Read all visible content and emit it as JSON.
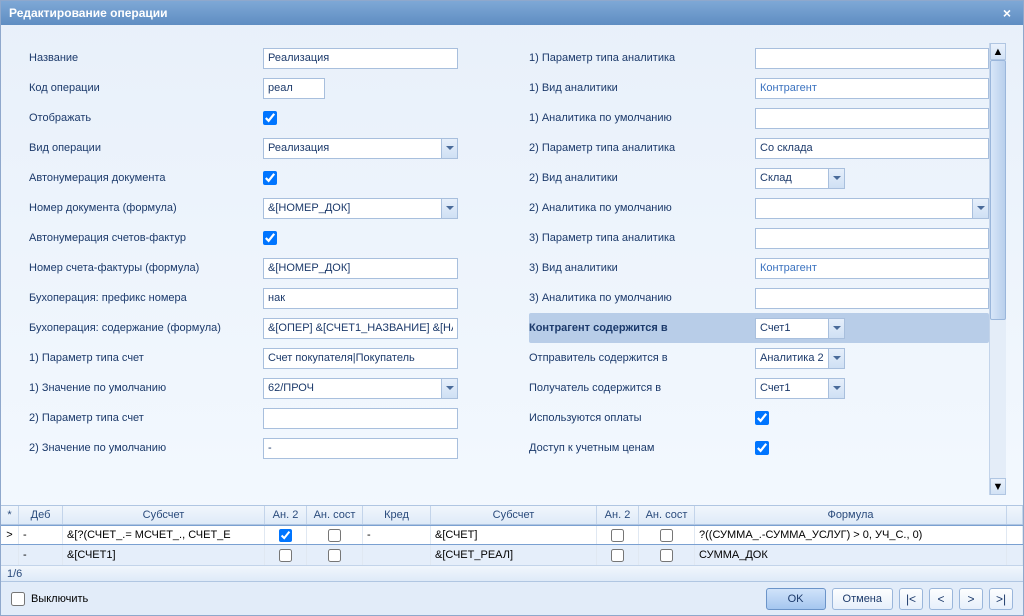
{
  "title": "Редактирование операции",
  "form": {
    "name_label": "Название",
    "name_value": "Реализация",
    "code_label": "Код операции",
    "code_value": "реал",
    "display_label": "Отображать",
    "display_checked": true,
    "optype_label": "Вид операции",
    "optype_value": "Реализация",
    "autonum_doc_label": "Автонумерация документа",
    "autonum_doc_checked": true,
    "docnum_formula_label": "Номер документа (формула)",
    "docnum_formula_value": "&[НОМЕР_ДОК]",
    "autonum_invoice_label": "Автонумерация счетов-фактур",
    "autonum_invoice_checked": true,
    "invoice_formula_label": "Номер счета-фактуры (формула)",
    "invoice_formula_value": "&[НОМЕР_ДОК]",
    "buhop_prefix_label": "Бухоперация: префикс номера",
    "buhop_prefix_value": "нак",
    "buhop_content_label": "Бухоперация: содержание (формула)",
    "buhop_content_value": "&[ОПЕР] &[СЧЕТ1_НАЗВАНИЕ] &[НА",
    "param1_acct_label": "1) Параметр типа счет",
    "param1_acct_value": "Счет покупателя|Покупатель",
    "default1_label": "1) Значение по умолчанию",
    "default1_value": "62/ПРОЧ",
    "param2_acct_label": "2) Параметр типа счет",
    "param2_acct_value": "",
    "default2_label": "2) Значение по умолчанию",
    "default2_value": "-",
    "param1_analytic_label": "1) Параметр типа аналитика",
    "param1_analytic_value": "",
    "analytic1_type_label": "1) Вид аналитики",
    "analytic1_type_value": "Контрагент",
    "analytic1_default_label": "1) Аналитика по умолчанию",
    "analytic1_default_value": "",
    "param2_analytic_label": "2) Параметр типа аналитика",
    "param2_analytic_value": "Со склада",
    "analytic2_type_label": "2) Вид аналитики",
    "analytic2_type_value": "Склад",
    "analytic2_default_label": "2) Аналитика по умолчанию",
    "analytic2_default_value": "",
    "param3_analytic_label": "3) Параметр типа аналитика",
    "param3_analytic_value": "",
    "analytic3_type_label": "3) Вид аналитики",
    "analytic3_type_value": "Контрагент",
    "analytic3_default_label": "3) Аналитика по умолчанию",
    "analytic3_default_value": "",
    "counterparty_in_label": "Контрагент содержится в",
    "counterparty_in_value": "Счет1",
    "sender_in_label": "Отправитель содержится в",
    "sender_in_value": "Аналитика 2",
    "recipient_in_label": "Получатель содержится в",
    "recipient_in_value": "Счет1",
    "payments_used_label": "Используются оплаты",
    "payments_used_checked": true,
    "access_prices_label": "Доступ к учетным ценам",
    "access_prices_checked": true
  },
  "grid": {
    "headers": {
      "marker": "*",
      "deb": "Деб",
      "sub1": "Субсчет",
      "an2a": "Ан. 2",
      "ansa": "Ан. сост",
      "kred": "Кред",
      "sub2": "Субсчет",
      "an2b": "Ан. 2",
      "ansb": "Ан. сост",
      "formula": "Формула"
    },
    "rows": [
      {
        "marker": ">",
        "deb": "-",
        "sub1": "&[?(СЧЕТ_.= МСЧЕТ_., СЧЕТ_Е",
        "an2a_checked": true,
        "ansa_checked": false,
        "kred": "-",
        "sub2": "&[СЧЕТ]",
        "an2b_checked": false,
        "ansb_checked": false,
        "formula": "?((СУММА_.-СУММА_УСЛУГ) > 0, УЧ_С., 0)"
      },
      {
        "marker": "",
        "deb": "-",
        "sub1": "&[СЧЕТ1]",
        "an2a_checked": false,
        "ansa_checked": false,
        "kred": "",
        "sub2": "&[СЧЕТ_РЕАЛ]",
        "an2b_checked": false,
        "ansb_checked": false,
        "formula": "СУММА_ДОК"
      }
    ],
    "footer": "1/6"
  },
  "bottom": {
    "disable_label": "Выключить",
    "ok": "OK",
    "cancel": "Отмена"
  }
}
